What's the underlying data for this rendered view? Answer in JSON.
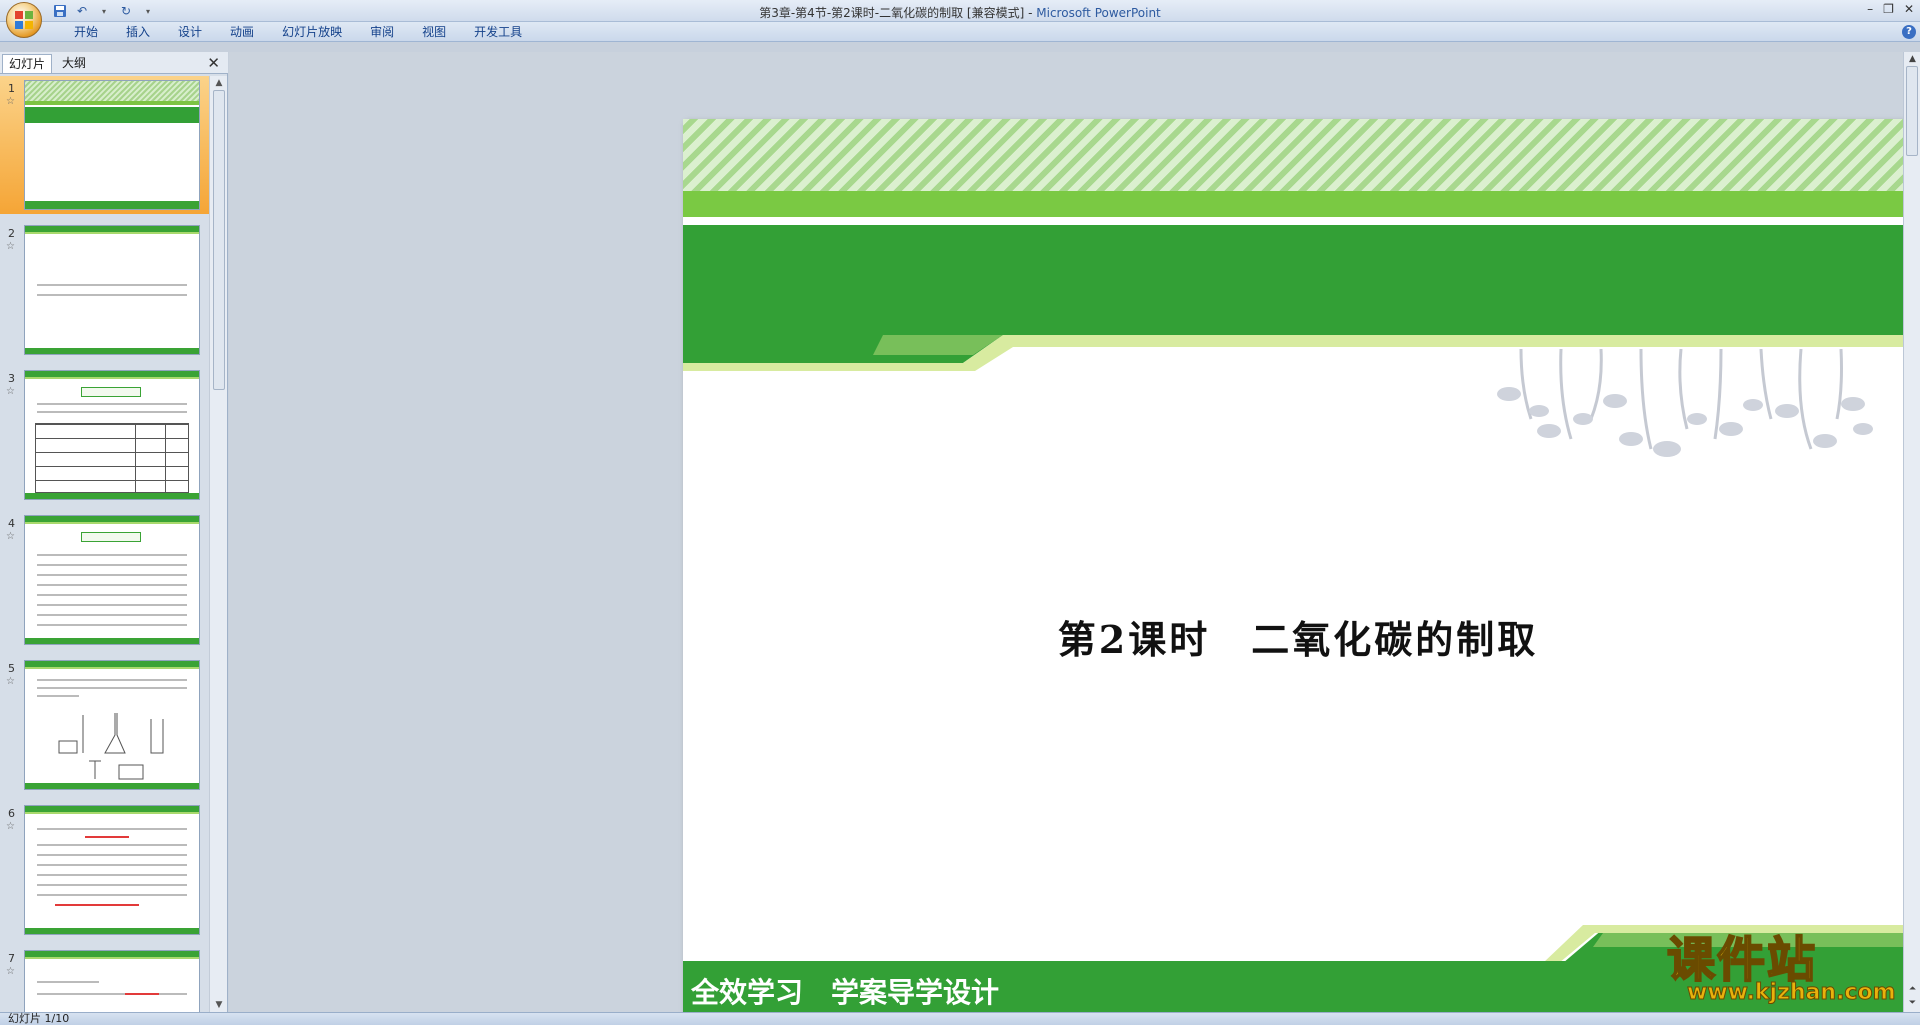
{
  "window": {
    "title": "第3章-第4节-第2课时-二氧化碳的制取 [兼容模式]",
    "app_name": "Microsoft PowerPoint",
    "separator": " - "
  },
  "ribbon": {
    "tabs": [
      "开始",
      "插入",
      "设计",
      "动画",
      "幻灯片放映",
      "审阅",
      "视图",
      "开发工具"
    ]
  },
  "left_pane": {
    "tabs": [
      "幻灯片",
      "大纲"
    ],
    "active_tab": "幻灯片",
    "slide_numbers": [
      "1",
      "2",
      "3",
      "4",
      "5",
      "6",
      "7"
    ],
    "selected_slide": "1"
  },
  "slide": {
    "title": "第2课时　二氧化碳的制取",
    "footer": "全效学习　学案导学设计"
  },
  "watermark": {
    "name": "课件站",
    "url": "www.kjzhan.com"
  },
  "status": {
    "text": "幻灯片 1/10"
  },
  "colors": {
    "accent_green": "#33a036",
    "light_green": "#7ac943",
    "office_orange": "#e3951f"
  },
  "icons": {
    "office_button": "office-logo-icon",
    "save": "save-icon",
    "undo": "undo-icon",
    "redo": "redo-icon",
    "help": "help-icon",
    "close": "close-icon"
  }
}
